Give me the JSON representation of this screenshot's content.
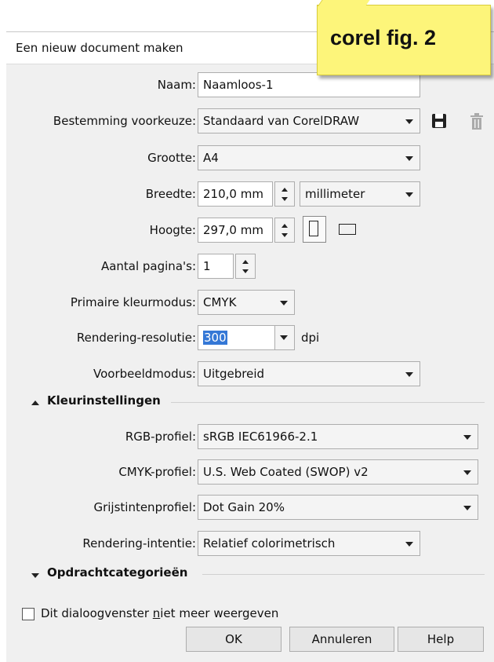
{
  "title": "Een nieuw document maken",
  "sticky_note": "corel fig. 2",
  "fields": {
    "naam": {
      "label": "Naam:",
      "value": "Naamloos-1"
    },
    "bestemming": {
      "label": "Bestemming voorkeuze:",
      "value": "Standaard van CorelDRAW"
    },
    "grootte": {
      "label": "Grootte:",
      "value": "A4"
    },
    "breedte": {
      "label": "Breedte:",
      "value": "210,0 mm",
      "unit": "millimeter"
    },
    "hoogte": {
      "label": "Hoogte:",
      "value": "297,0 mm"
    },
    "paginas": {
      "label": "Aantal pagina's:",
      "value": "1"
    },
    "kleurmodus": {
      "label": "Primaire kleurmodus:",
      "value": "CMYK"
    },
    "resolutie": {
      "label": "Rendering-resolutie:",
      "value": "300",
      "unit": "dpi"
    },
    "voorbeeld": {
      "label": "Voorbeeldmodus:",
      "value": "Uitgebreid"
    }
  },
  "kleur_section": {
    "title": "Kleurinstellingen",
    "rgb": {
      "label": "RGB-profiel:",
      "value": "sRGB IEC61966-2.1"
    },
    "cmyk": {
      "label": "CMYK-profiel:",
      "value": "U.S. Web Coated (SWOP) v2"
    },
    "grijs": {
      "label": "Grijstintenprofiel:",
      "value": "Dot Gain 20%"
    },
    "intentie": {
      "label": "Rendering-intentie:",
      "value": "Relatief colorimetrisch"
    }
  },
  "opdracht_section": {
    "title": "Opdrachtcategorieën"
  },
  "checkbox": {
    "before": "Dit dialoogvenster ",
    "underlined": "n",
    "after": "iet meer weergeven",
    "checked": false
  },
  "buttons": {
    "ok": "OK",
    "cancel": "Annuleren",
    "help": "Help"
  },
  "icons": {
    "save": "save-icon",
    "delete": "trash-icon",
    "portrait": "portrait-icon",
    "landscape": "landscape-icon"
  }
}
